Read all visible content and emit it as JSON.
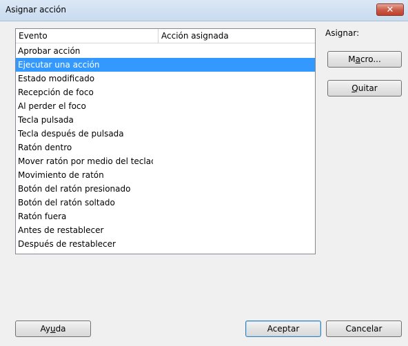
{
  "window": {
    "title": "Asignar acción",
    "close_label": "✕"
  },
  "list": {
    "columns": [
      "Evento",
      "Acción asignada"
    ],
    "rows": [
      {
        "event": "Aprobar acción",
        "action": ""
      },
      {
        "event": "Ejecutar una acción",
        "action": "",
        "selected": true
      },
      {
        "event": "Estado modificado",
        "action": ""
      },
      {
        "event": "Recepción de foco",
        "action": ""
      },
      {
        "event": "Al perder el foco",
        "action": ""
      },
      {
        "event": "Tecla pulsada",
        "action": ""
      },
      {
        "event": "Tecla después de pulsada",
        "action": ""
      },
      {
        "event": "Ratón dentro",
        "action": ""
      },
      {
        "event": "Mover ratón por medio del teclado",
        "action": ""
      },
      {
        "event": "Movimiento de ratón",
        "action": ""
      },
      {
        "event": "Botón del ratón presionado",
        "action": ""
      },
      {
        "event": "Botón del ratón soltado",
        "action": ""
      },
      {
        "event": "Ratón fuera",
        "action": ""
      },
      {
        "event": "Antes de restablecer",
        "action": ""
      },
      {
        "event": "Después de restablecer",
        "action": ""
      }
    ]
  },
  "assign": {
    "label": "Asignar:",
    "macro_button": {
      "pre": "M",
      "mnemonic": "a",
      "post": "cro..."
    },
    "remove_button": {
      "pre": "",
      "mnemonic": "Q",
      "post": "uitar"
    }
  },
  "footer": {
    "help_button": {
      "pre": "Ay",
      "mnemonic": "u",
      "post": "da"
    },
    "ok_label": "Aceptar",
    "cancel_label": "Cancelar"
  },
  "colors": {
    "selection": "#3399ff",
    "titlebar": "#c9dbef",
    "close": "#c85a48"
  }
}
